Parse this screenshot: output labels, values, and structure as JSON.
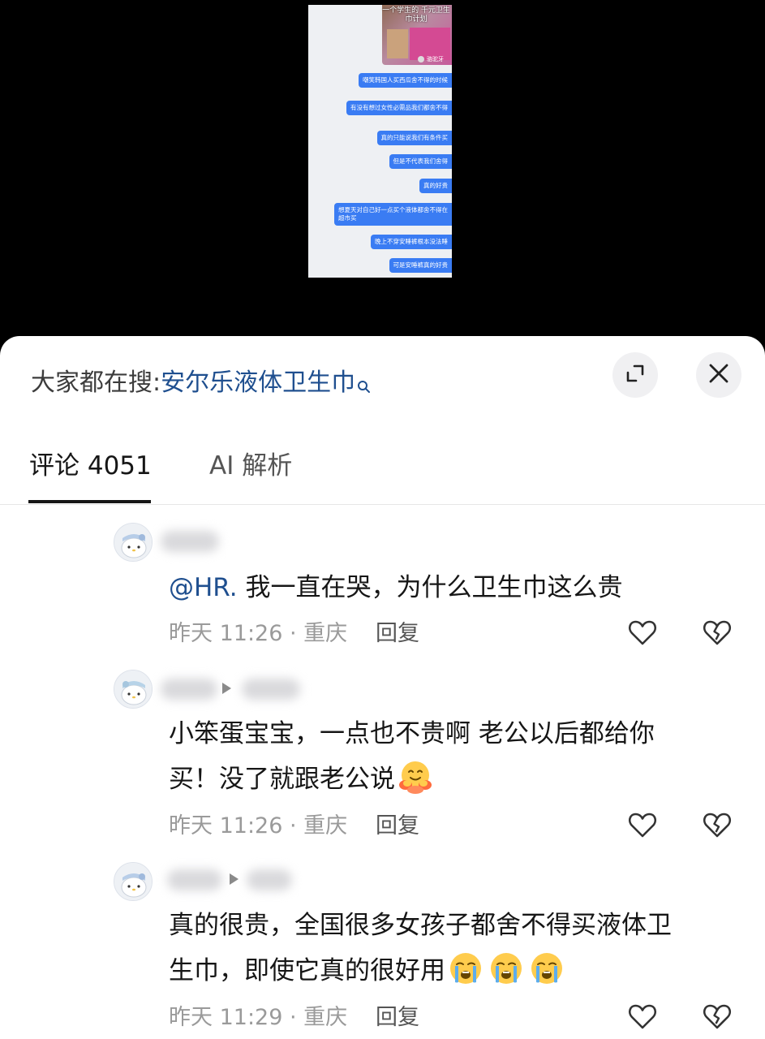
{
  "video": {
    "overlay_text": "一个学生的 千元卫生巾计划",
    "overlay_user": "骆驼牙",
    "chat_bubbles": [
      "嘲笑韩国人买西瓜舍不得的时候",
      "有没有想过女性必需品我们都舍不得",
      "真的只能说我们有条件买",
      "但是不代表我们舍得",
      "真的好贵",
      "想夏天对自己好一点买个液体都舍不得在超市买",
      "晚上不穿安睡裤根本没法睡",
      "可是安睡裤真的好贵"
    ]
  },
  "sheet": {
    "search_prefix": "大家都在搜:",
    "search_term": "安尔乐液体卫生巾",
    "tabs": {
      "comments": "评论 4051",
      "ai": "AI 解析"
    },
    "icons": {
      "expand": "expand-icon",
      "close": "close-icon",
      "search": "search-icon",
      "like": "heart-icon",
      "dislike": "broken-heart-icon"
    }
  },
  "comments": [
    {
      "mention": "@HR.",
      "text": " 我一直在哭，为什么卫生巾这么贵",
      "meta": "昨天 11:26 · 重庆",
      "reply": "回复"
    },
    {
      "line1": "小笨蛋宝宝，一点也不贵啊 老公以后都给你",
      "line2": "买！没了就跟老公说",
      "emoji": "hugging-face-emoji",
      "meta": "昨天 11:26 · 重庆",
      "reply": "回复"
    },
    {
      "line1": "真的很贵，全国很多女孩子都舍不得买液体卫",
      "line2": "生巾，即使它真的很好用",
      "emoji": "loudly-crying-face-emoji",
      "meta": "昨天 11:29 · 重庆",
      "reply": "回复"
    }
  ]
}
